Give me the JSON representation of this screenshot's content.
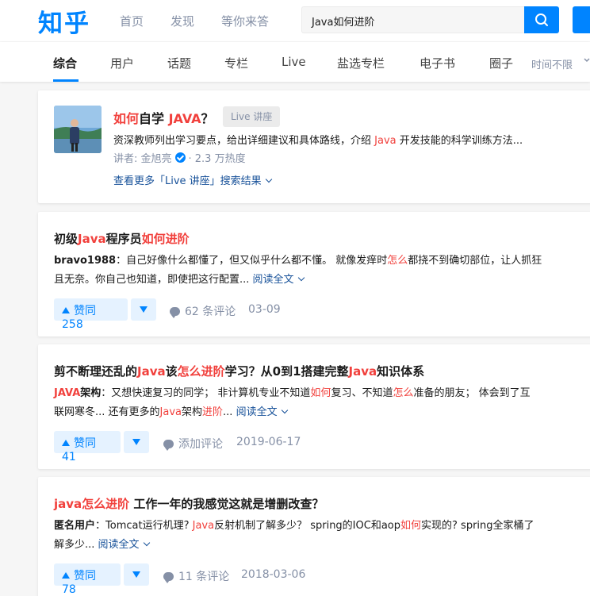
{
  "header": {
    "logo": "知乎",
    "nav": [
      "首页",
      "发现",
      "等你来答"
    ],
    "search_value": "Java如何进阶",
    "brand_color": "#0084ff"
  },
  "tabs": {
    "items": [
      "综合",
      "用户",
      "话题",
      "专栏",
      "Live",
      "盐选专栏",
      "电子书",
      "圈子"
    ],
    "active": "综合",
    "time_filter": "时间不限"
  },
  "live_card": {
    "title_parts": [
      "如何",
      "自学 ",
      "JAVA",
      "？"
    ],
    "tag": "Live 讲座",
    "desc_parts": [
      "资深教师列出学习要点，给出详细建议和具体路线，介绍 ",
      "Java",
      " 开发技能的科学训练方法..."
    ],
    "speaker_label": "讲者: 金旭亮",
    "heat": "· 2.3 万热度",
    "more_link": "查看更多「Live 讲座」搜索结果"
  },
  "results": [
    {
      "title_parts": [
        "初级",
        "Java",
        "程序员",
        "如何进阶"
      ],
      "excerpt_line1": [
        "bravo1988",
        "：自己好像什么都懂了，但又似乎什么都不懂。 就像发痒时",
        "怎么",
        "都挠不到确切部位，让人抓狂"
      ],
      "excerpt_line2": "且无奈。你自己也知道，即使把这行配置...",
      "read_more": "阅读全文",
      "votes": "赞同 258",
      "comments": "62 条评论",
      "date": "03-09"
    },
    {
      "title_parts": [
        "剪不断理还乱的",
        "Java",
        "该",
        "怎么进阶",
        "学习？从0到1搭建完整",
        "Java",
        "知识体系"
      ],
      "excerpt_line1": [
        "JAVA",
        "架构",
        "：又想快速复习的同学； 非计算机专业不知道",
        "如何",
        "复习、不知道",
        "怎么",
        "准备的朋友； 体会到了互"
      ],
      "excerpt_line2": [
        "联网寒冬... 还有更多的",
        "Java",
        "架构",
        "进阶",
        "..."
      ],
      "read_more": "阅读全文",
      "votes": "赞同 41",
      "comments": "添加评论",
      "date": "2019-06-17"
    },
    {
      "title_parts": [
        "java",
        "怎么进阶",
        " 工作一年的我感觉这就是增删改查？"
      ],
      "excerpt_line1": [
        "匿名用户",
        "：Tomcat运行机理? ",
        "Java",
        "反射机制了解多少？ spring的IOC和aop",
        "如何",
        "实现的? spring全家桶了"
      ],
      "excerpt_line2": "解多少...",
      "read_more": "阅读全文",
      "votes": "赞同 78",
      "comments": "11 条评论",
      "date": "2018-03-06"
    }
  ],
  "colors": {
    "highlight": "#f1403c",
    "link": "#175199",
    "muted": "#8590a6"
  }
}
